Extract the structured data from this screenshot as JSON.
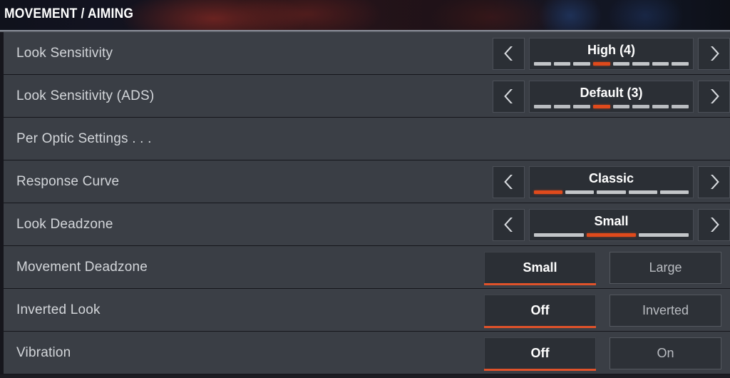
{
  "header": {
    "title": "MOVEMENT / AIMING"
  },
  "icons": {
    "left_arrow": "chevron-left-icon",
    "right_arrow": "chevron-right-icon"
  },
  "colors": {
    "accent": "#e04a1c",
    "row_bg": "#3b3f46",
    "panel_bg": "#2b2f35",
    "label_text": "#d3d6da",
    "value_text": "#ffffff"
  },
  "rows": [
    {
      "label": "Look Sensitivity",
      "type": "slider",
      "value": "High  (4)",
      "segments": 8,
      "active_segment": 4
    },
    {
      "label": "Look Sensitivity  (ADS)",
      "type": "slider",
      "value": "Default (3)",
      "segments": 8,
      "active_segment": 4
    },
    {
      "label": "Per Optic Settings . . .",
      "type": "link"
    },
    {
      "label": "Response Curve",
      "type": "slider",
      "value": "Classic",
      "segments": 5,
      "active_segment": 1
    },
    {
      "label": "Look Deadzone",
      "type": "slider",
      "value": "Small",
      "segments": 3,
      "active_segment": 2
    },
    {
      "label": "Movement Deadzone",
      "type": "toggle",
      "options": [
        "Small",
        "Large"
      ],
      "selected": 0
    },
    {
      "label": "Inverted Look",
      "type": "toggle",
      "options": [
        "Off",
        "Inverted"
      ],
      "selected": 0
    },
    {
      "label": "Vibration",
      "type": "toggle",
      "options": [
        "Off",
        "On"
      ],
      "selected": 0
    }
  ]
}
